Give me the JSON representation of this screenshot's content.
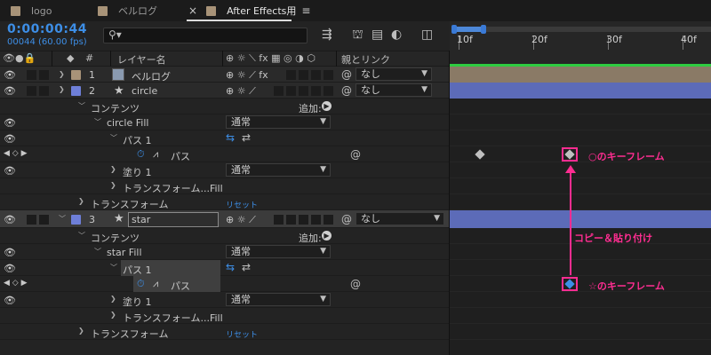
{
  "tabs": [
    {
      "label": "logo"
    },
    {
      "label": "ベルログ"
    },
    {
      "label": "After Effects用",
      "active": true
    }
  ],
  "tab_close": "×",
  "tab_menu": "≡",
  "timecode": "0:00:00:44",
  "fps": "00044 (60.00 fps)",
  "search_icon": "search-icon",
  "ruler": {
    "labels": [
      "10f",
      "20f",
      "30f",
      "40f"
    ]
  },
  "columns": {
    "num": "#",
    "layer_name": "レイヤー名",
    "switches": "⊕ ☼ ⟍ fx ▦ ◎ ◑ ⬡",
    "parent": "親とリンク"
  },
  "layers": [
    {
      "num": "1",
      "name": "ベルログ",
      "parent": "なし",
      "color": "#a89378"
    },
    {
      "num": "2",
      "name": "circle",
      "parent": "なし",
      "color": "#6e7fd8"
    },
    {
      "num": "3",
      "name": "star",
      "parent": "なし",
      "color": "#6e7fd8"
    }
  ],
  "rows": {
    "contents": "コンテンツ",
    "add": "追加:",
    "circle_fill": "circle Fill",
    "normal": "通常",
    "path1": "パス 1",
    "path": "パス",
    "fill1": "塗り 1",
    "transform_fill": "トランスフォーム...Fill",
    "transform": "トランスフォーム",
    "reset": "リセット",
    "star_fill": "star Fill"
  },
  "annotations": {
    "circle_kf": "○のキーフレーム",
    "copy_paste": "コピー＆貼り付け",
    "star_kf": "☆のキーフレーム"
  },
  "colors": {
    "accent_blue": "#3d8ee6",
    "annotation_pink": "#ff2d91",
    "label_tan": "#a89378",
    "label_blue": "#6e7fd8",
    "track_blue": "#5c6bb8",
    "track_tan": "#8a7a66",
    "green_bar": "#2ecc40"
  }
}
